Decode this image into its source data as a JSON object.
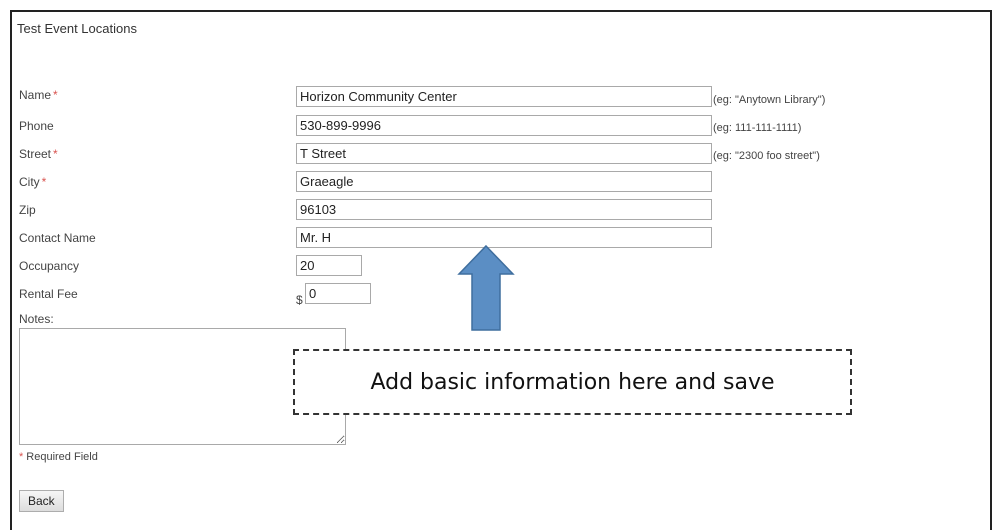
{
  "page": {
    "title": "Test Event Locations"
  },
  "form": {
    "name": {
      "label": "Name",
      "required": "*",
      "value": "Horizon Community Center",
      "hint": "(eg: \"Anytown Library\")"
    },
    "phone": {
      "label": "Phone",
      "value": "530-899-9996",
      "hint": "(eg: 111-111-1111)"
    },
    "street": {
      "label": "Street",
      "required": "*",
      "value": "T Street",
      "hint": "(eg: \"2300 foo street\")"
    },
    "city": {
      "label": "City",
      "required": "*",
      "value": "Graeagle"
    },
    "zip": {
      "label": "Zip",
      "value": "96103"
    },
    "contact": {
      "label": "Contact Name",
      "value": "Mr. H"
    },
    "occupancy": {
      "label": "Occupancy",
      "value": "20"
    },
    "rental_fee": {
      "label": "Rental Fee",
      "currency": "$",
      "value": "0"
    },
    "notes": {
      "label": "Notes:",
      "value": ""
    },
    "required_note": {
      "marker": "*",
      "text": "Required Field"
    },
    "back_label": "Back"
  },
  "annotation": {
    "text": "Add basic information here and save",
    "arrow_color": "#5b8ec4"
  }
}
